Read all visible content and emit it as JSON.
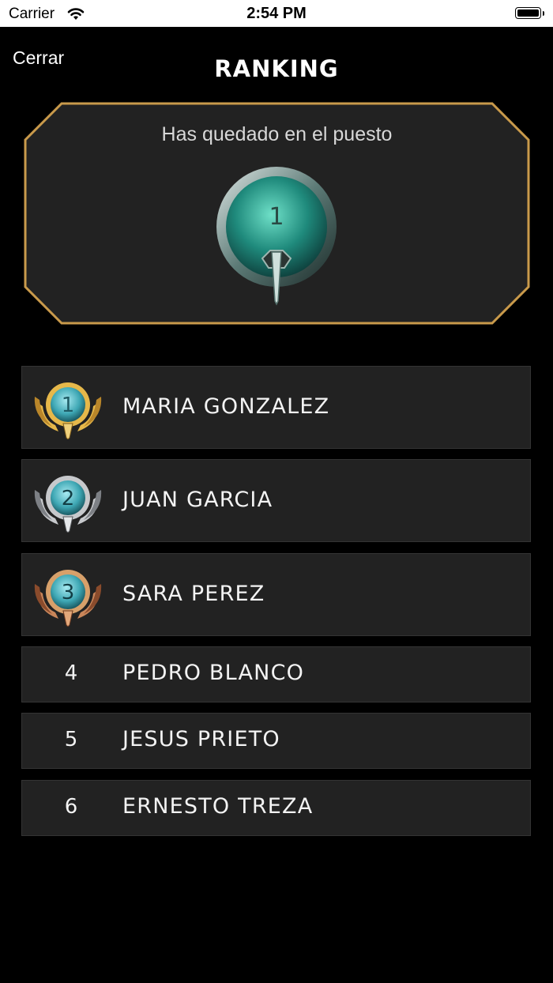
{
  "status_bar": {
    "carrier": "Carrier",
    "time": "2:54 PM"
  },
  "nav": {
    "close_label": "Cerrar",
    "title": "RANKING"
  },
  "result": {
    "caption": "Has quedado en el puesto",
    "position": "1"
  },
  "ranking": [
    {
      "position": "1",
      "name": "MARIA GONZALEZ",
      "medal": "gold"
    },
    {
      "position": "2",
      "name": "JUAN GARCIA",
      "medal": "silver"
    },
    {
      "position": "3",
      "name": "SARA PEREZ",
      "medal": "bronze"
    },
    {
      "position": "4",
      "name": "PEDRO BLANCO"
    },
    {
      "position": "5",
      "name": "JESUS PRIETO"
    },
    {
      "position": "6",
      "name": "ERNESTO TREZA"
    }
  ],
  "colors": {
    "panel_border": "#c99a4b",
    "panel_fill": "#222222",
    "gold": "#e6b84a",
    "silver": "#c7c9cc",
    "bronze": "#c9865a",
    "medal_teal": "#3ea7b4"
  }
}
